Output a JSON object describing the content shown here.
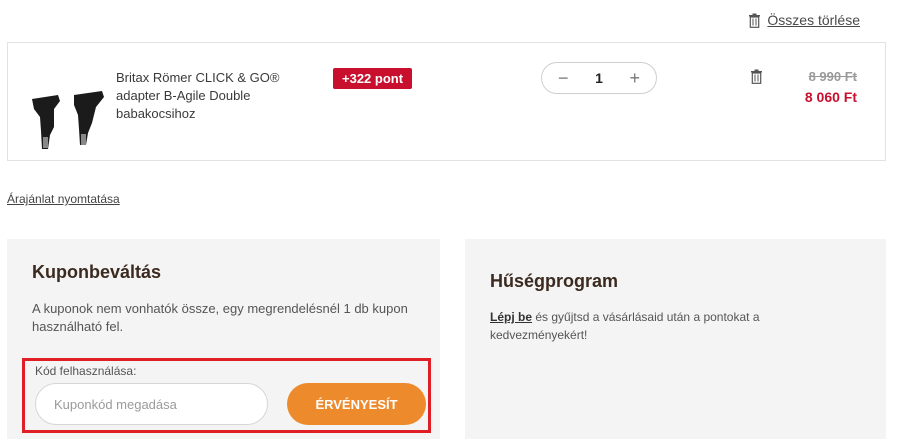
{
  "cart": {
    "clear_all_label": "Összes törlése",
    "item": {
      "name": "Britax Römer CLICK & GO® adapter B-Agile Double babakocsihoz",
      "points_badge": "+322 pont",
      "quantity": "1",
      "qty_minus": "−",
      "qty_plus": "+",
      "price_old": "8 990 Ft",
      "price_new": "8 060 Ft"
    }
  },
  "print_quote_label": "Árajánlat nyomtatása",
  "coupon": {
    "title": "Kuponbeváltás",
    "description": "A kuponok nem vonhatók össze, egy megrendelésnél 1 db kupon használható fel.",
    "code_label": "Kód felhasználása:",
    "input_placeholder": "Kuponkód megadása",
    "input_value": "",
    "apply_label": "ÉRVÉNYESÍT"
  },
  "loyalty": {
    "title": "Hűségprogram",
    "login_link": "Lépj be",
    "description_rest": " és gyűjtsd a vásárlásaid után a pontokat a kedvezményekért!"
  },
  "colors": {
    "accent_orange": "#ec8a2c",
    "price_red": "#c8102e",
    "highlight_red": "#e01e26",
    "panel_bg": "#f4f4f4"
  }
}
